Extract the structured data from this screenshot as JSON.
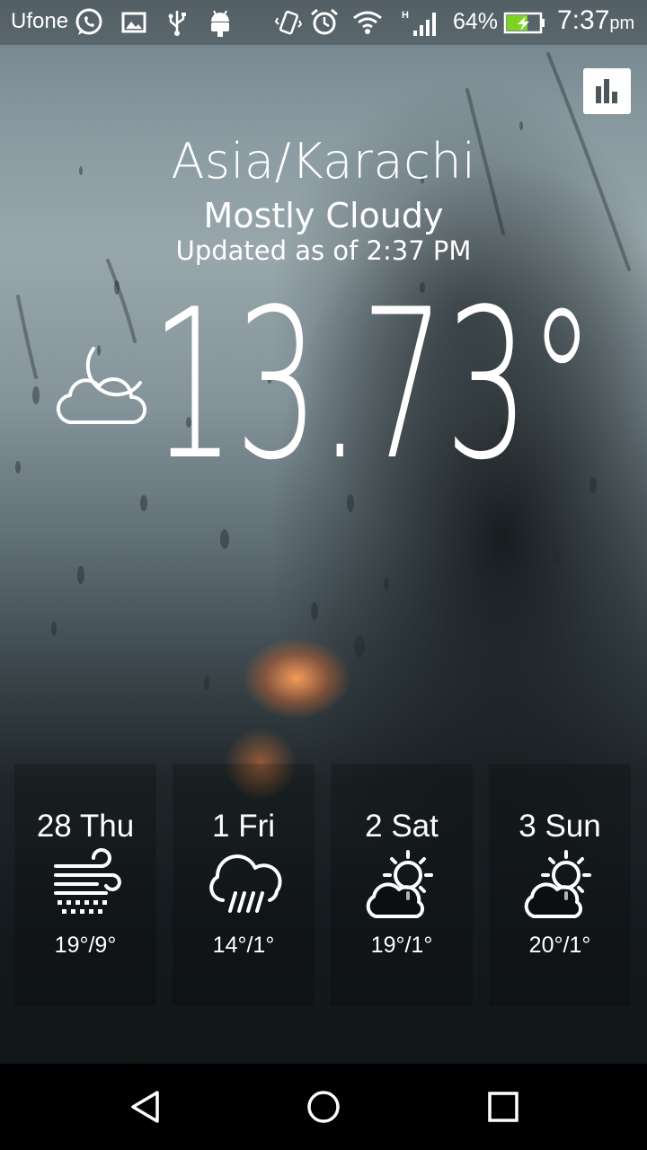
{
  "status_bar": {
    "carrier": "Ufone",
    "battery_percent": "64%",
    "battery_level": 0.64,
    "time": "7:37",
    "ampm": "pm",
    "icons": [
      "whatsapp-icon",
      "image-icon",
      "usb-icon",
      "android-icon",
      "vibrate-icon",
      "alarm-icon",
      "wifi-icon",
      "signal-h-icon",
      "battery-charging-icon"
    ]
  },
  "header": {
    "chart_button_icon": "bar-chart-icon"
  },
  "current": {
    "city": "Asia/Karachi",
    "condition": "Mostly Cloudy",
    "updated": "Updated as of 2:37 PM",
    "temperature": "13.73°",
    "icon": "cloud-moon-icon"
  },
  "forecast": [
    {
      "day": "28 Thu",
      "range": "19°/9°",
      "icon": "wind-rain-icon"
    },
    {
      "day": "1 Fri",
      "range": "14°/1°",
      "icon": "cloud-rain-icon"
    },
    {
      "day": "2 Sat",
      "range": "19°/1°",
      "icon": "partly-sunny-icon"
    },
    {
      "day": "3 Sun",
      "range": "20°/1°",
      "icon": "partly-sunny-icon"
    }
  ],
  "navbar": {
    "icons": [
      "back-icon",
      "home-icon",
      "recents-icon"
    ]
  },
  "colors": {
    "text": "#ffffff",
    "battery_fill": "#7ed321",
    "navbar": "#000000"
  }
}
